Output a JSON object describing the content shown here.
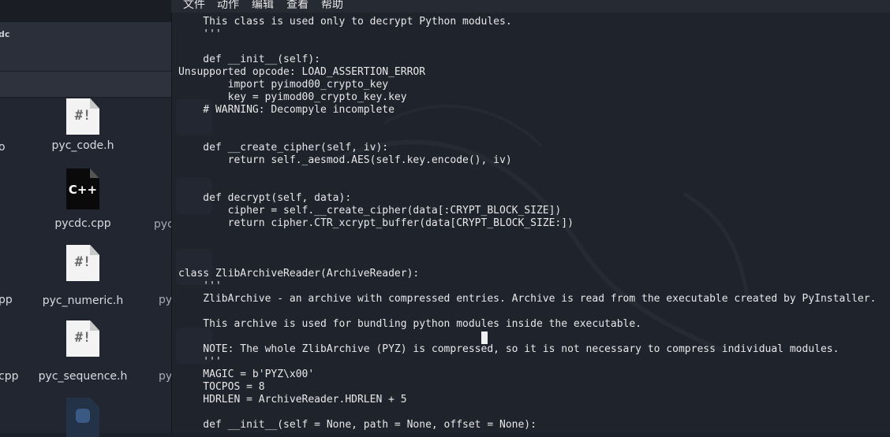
{
  "menubar": {
    "items": [
      "文件",
      "动作",
      "编辑",
      "查看",
      "帮助"
    ]
  },
  "file_manager": {
    "title_fragment": "dc",
    "files": [
      {
        "name": "pyc_code.h",
        "icon": "header-file-icon"
      },
      {
        "name": "pycdc.cpp",
        "icon": "cpp-file-icon"
      },
      {
        "name": "pyc_numeric.h",
        "icon": "header-file-icon"
      },
      {
        "name": "pyc_sequence.h",
        "icon": "header-file-icon"
      },
      {
        "name": "",
        "icon": "python-file-icon"
      }
    ],
    "left_fragments": [
      "o",
      "pp",
      "cpp"
    ],
    "right_fragments": [
      "pyc",
      "py",
      "py"
    ]
  },
  "terminal": {
    "lines": [
      "    This class is used only to decrypt Python modules.",
      "    '''",
      "",
      "    def __init__(self):",
      "Unsupported opcode: LOAD_ASSERTION_ERROR",
      "        import pyimod00_crypto_key",
      "        key = pyimod00_crypto_key.key",
      "    # WARNING: Decompyle incomplete",
      "",
      "",
      "    def __create_cipher(self, iv):",
      "        return self._aesmod.AES(self.key.encode(), iv)",
      "",
      "",
      "    def decrypt(self, data):",
      "        cipher = self.__create_cipher(data[:CRYPT_BLOCK_SIZE])",
      "        return cipher.CTR_xcrypt_buffer(data[CRYPT_BLOCK_SIZE:])",
      "",
      "",
      "",
      "class ZlibArchiveReader(ArchiveReader):",
      "    '''",
      "    ZlibArchive - an archive with compressed entries. Archive is read from the executable created by PyInstaller.",
      "",
      "    This archive is used for bundling python modules inside the executable.",
      "",
      "    NOTE: The whole ZlibArchive (PYZ) is compressed, so it is not necessary to compress individual modules.",
      "    '''",
      "    MAGIC = b'PYZ\\x00'",
      "    TOCPOS = 8",
      "    HDRLEN = ArchiveReader.HDRLEN + 5",
      "",
      "    def __init__(self = None, path = None, offset = None):"
    ]
  },
  "colors": {
    "terminal_bg": "#1f232b",
    "terminal_text": "#e8e8e8",
    "file_manager_bg": "#222631"
  }
}
